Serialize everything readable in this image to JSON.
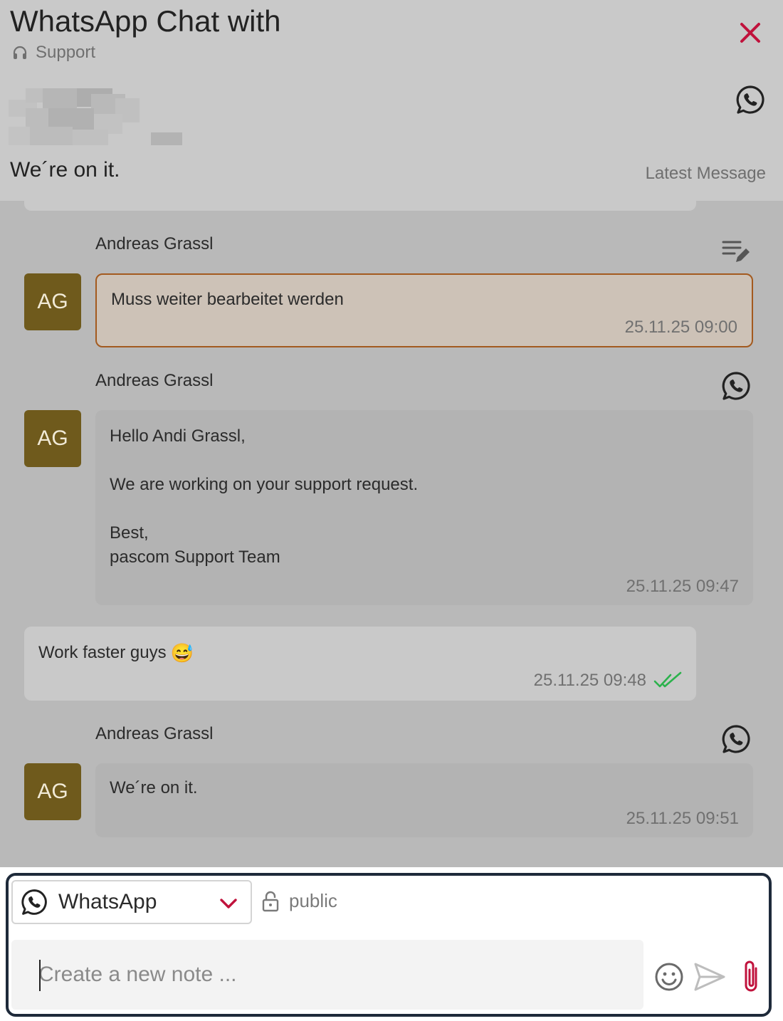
{
  "header": {
    "title": "WhatsApp Chat with",
    "subtitle": "Support",
    "subtitle_icon": "headset-icon",
    "close_icon": "close-icon",
    "channel_icon": "whatsapp-icon",
    "latest_message_text": "We´re on it.",
    "latest_message_label": "Latest Message"
  },
  "messages": [
    {
      "sender": "Andreas Grassl",
      "avatar": "AG",
      "type": "note",
      "icon": "edit-note-icon",
      "text": "Muss weiter bearbeitet werden",
      "time": "25.11.25 09:00"
    },
    {
      "sender": "Andreas Grassl",
      "avatar": "AG",
      "type": "whatsapp",
      "icon": "whatsapp-icon",
      "text": "Hello Andi Grassl,\n\nWe are working on your support request.\n\nBest,\npascom Support Team",
      "time": "25.11.25 09:47"
    },
    {
      "sender": "",
      "type": "incoming",
      "text": "Work faster guys",
      "emoji": "😅",
      "time": "25.11.25 09:48",
      "status_icon": "double-check-icon"
    },
    {
      "sender": "Andreas Grassl",
      "avatar": "AG",
      "type": "whatsapp",
      "icon": "whatsapp-icon",
      "text": "We´re on it.",
      "time": "25.11.25 09:51"
    }
  ],
  "composer": {
    "channel": "WhatsApp",
    "visibility": "public",
    "placeholder": "Create a new note ...",
    "value": ""
  },
  "colors": {
    "accent": "#c0123c",
    "avatar": "#6f5a1c",
    "note_border": "#a35a1f",
    "read_check": "#2bb24c",
    "composer_border": "#1e2a3a"
  }
}
